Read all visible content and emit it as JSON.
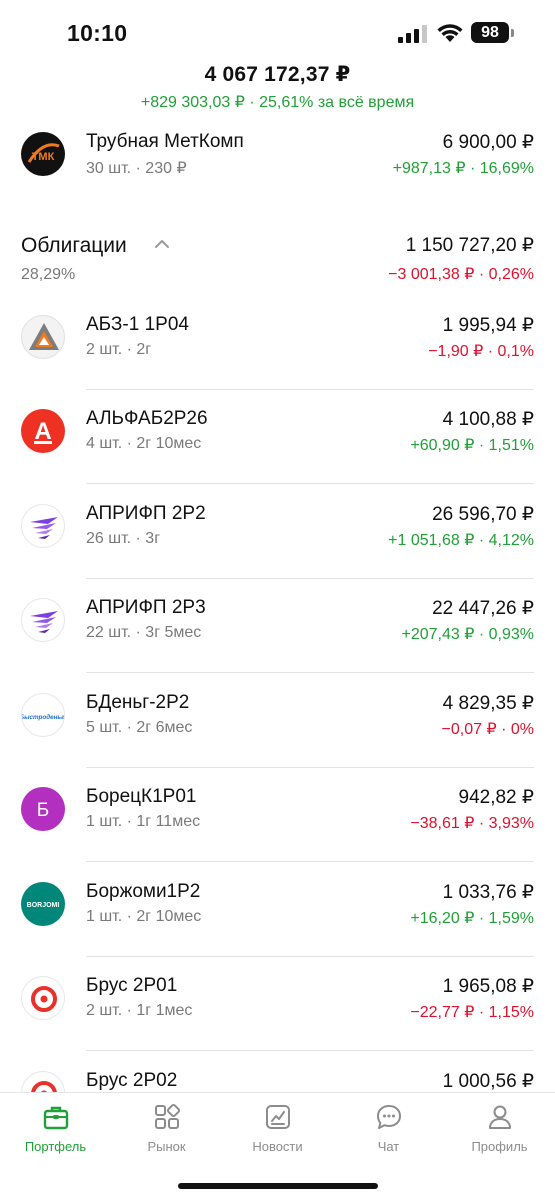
{
  "status": {
    "time": "10:10",
    "battery": "98"
  },
  "summary": {
    "total": "4 067 172,37 ₽",
    "change": "+829 303,03 ₽ · 25,61%",
    "period": "за всё время"
  },
  "stock": {
    "name": "Трубная МетКомп",
    "sub": "30 шт. · 230 ₽",
    "value": "6 900,00 ₽",
    "change": "+987,13 ₽ · 16,69%",
    "logo_text": "ТМК"
  },
  "section": {
    "title": "Облигации",
    "pct": "28,29%",
    "value": "1 150 727,20 ₽",
    "change": "−3 001,38 ₽ · 0,26%"
  },
  "bonds": [
    {
      "name": "АБЗ-1 1Р04",
      "sub": "2 шт. · 2г",
      "value": "1 995,94 ₽",
      "change": "−1,90 ₽ · 0,1%",
      "trend": "down"
    },
    {
      "name": "АЛЬФАБ2Р26",
      "sub": "4 шт. · 2г 10мес",
      "value": "4 100,88 ₽",
      "change": "+60,90 ₽ · 1,51%",
      "trend": "up"
    },
    {
      "name": "АПРИФП 2Р2",
      "sub": "26 шт. · 3г",
      "value": "26 596,70 ₽",
      "change": "+1 051,68 ₽ · 4,12%",
      "trend": "up"
    },
    {
      "name": "АПРИФП 2Р3",
      "sub": "22 шт. · 3г 5мес",
      "value": "22 447,26 ₽",
      "change": "+207,43 ₽ · 0,93%",
      "trend": "up"
    },
    {
      "name": "БДеньг-2Р2",
      "sub": "5 шт. · 2г 6мес",
      "value": "4 829,35 ₽",
      "change": "−0,07 ₽ · 0%",
      "trend": "down"
    },
    {
      "name": "БорецК1Р01",
      "sub": "1 шт. · 1г 11мес",
      "value": "942,82 ₽",
      "change": "−38,61 ₽ · 3,93%",
      "trend": "down"
    },
    {
      "name": "Боржоми1Р2",
      "sub": "1 шт. · 2г 10мес",
      "value": "1 033,76 ₽",
      "change": "+16,20 ₽ · 1,59%",
      "trend": "up"
    },
    {
      "name": "Брус 2Р01",
      "sub": "2 шт. · 1г 1мес",
      "value": "1 965,08 ₽",
      "change": "−22,77 ₽ · 1,15%",
      "trend": "down"
    },
    {
      "name": "Брус 2Р02",
      "sub": "",
      "value": "1 000,56 ₽",
      "change": "",
      "trend": "up"
    }
  ],
  "logos": {
    "alfa_letter": "А",
    "bystrodengi_text": "Быстроденьги",
    "borets_letter": "Б",
    "borjomi_text": "BORJOMI"
  },
  "tabs": [
    {
      "label": "Портфель",
      "icon": "briefcase-icon",
      "active": true
    },
    {
      "label": "Рынок",
      "icon": "grid-icon",
      "active": false
    },
    {
      "label": "Новости",
      "icon": "chart-icon",
      "active": false
    },
    {
      "label": "Чат",
      "icon": "chat-icon",
      "active": false
    },
    {
      "label": "Профиль",
      "icon": "person-icon",
      "active": false
    }
  ],
  "colors": {
    "positive": "#21a038",
    "negative": "#e0112e",
    "accent": "#21a038"
  }
}
